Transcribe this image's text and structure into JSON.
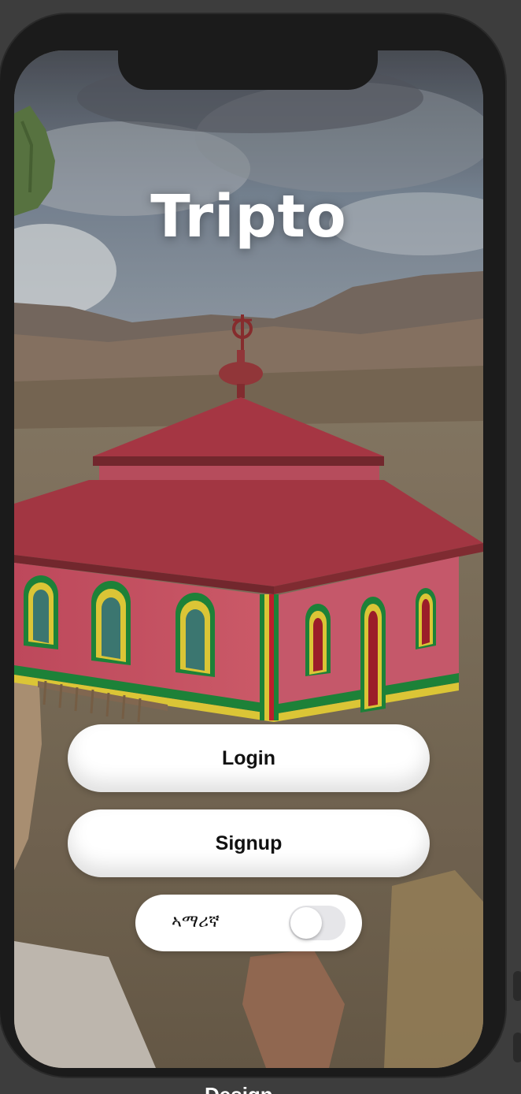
{
  "app": {
    "title": "Tripto"
  },
  "actions": {
    "login_label": "Login",
    "signup_label": "Signup"
  },
  "language": {
    "label": "ኣማሪኛ",
    "toggle_on": false
  },
  "footer": {
    "label": "Design"
  },
  "colors": {
    "background": "#3d3d3d",
    "phone_frame": "#1b1b1b",
    "button_bg": "#ffffff",
    "button_text": "#111111",
    "title_text": "#ffffff",
    "roof": "#a8323f",
    "walls": "#d9576b",
    "trim_green": "#1f8a3c",
    "trim_yellow": "#e9d23a"
  }
}
